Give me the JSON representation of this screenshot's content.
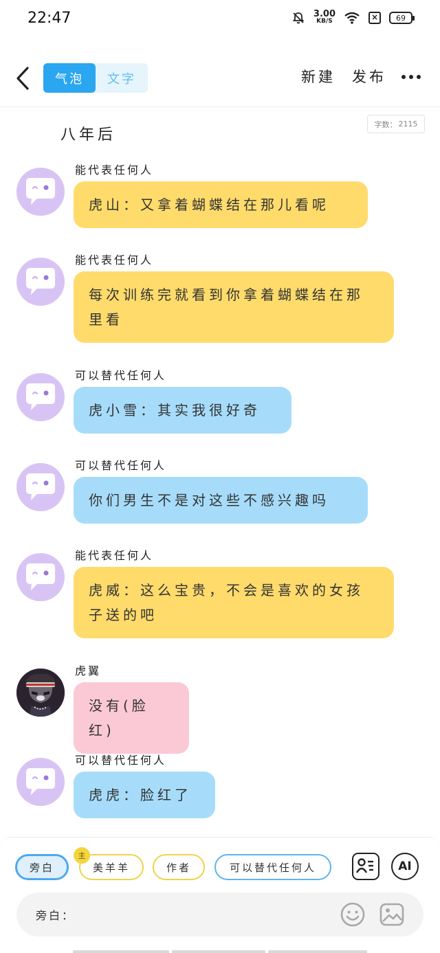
{
  "status": {
    "time": "22:47",
    "net_speed_value": "3.00",
    "net_speed_unit": "KB/S",
    "battery": "69"
  },
  "nav": {
    "tab_bubble": "气泡",
    "tab_text": "文字",
    "new_label": "新建",
    "publish_label": "发布"
  },
  "doc": {
    "title": "八年后",
    "word_count_label": "字数：",
    "word_count_value": "2115"
  },
  "messages": [
    {
      "sender": "能代表任何人",
      "text": "虎山：又拿着蝴蝶结在那儿看呢",
      "color": "#fedb6b"
    },
    {
      "sender": "能代表任何人",
      "text": "每次训练完就看到你拿着蝴蝶结在那里看",
      "color": "#fedb6b"
    },
    {
      "sender": "可以替代任何人",
      "text": "虎小雪：其实我很好奇",
      "color": "#a6dcfa"
    },
    {
      "sender": "可以替代任何人",
      "text": "你们男生不是对这些不感兴趣吗",
      "color": "#a6dcfa"
    },
    {
      "sender": "能代表任何人",
      "text": "虎威：这么宝贵，不会是喜欢的女孩子送的吧",
      "color": "#fedb6b"
    },
    {
      "sender": "虎翼",
      "text": "没有(脸红)",
      "color": "#fbc9d5"
    },
    {
      "sender": "可以替代任何人",
      "text": "虎虎：脸红了",
      "color": "#a6dcfa"
    }
  ],
  "roles": [
    {
      "label": "旁白"
    },
    {
      "label": "美羊羊",
      "badge": "主"
    },
    {
      "label": "作者"
    },
    {
      "label": "可以替代任何人"
    }
  ],
  "ai_label": "AI",
  "input": {
    "label": "旁白："
  }
}
